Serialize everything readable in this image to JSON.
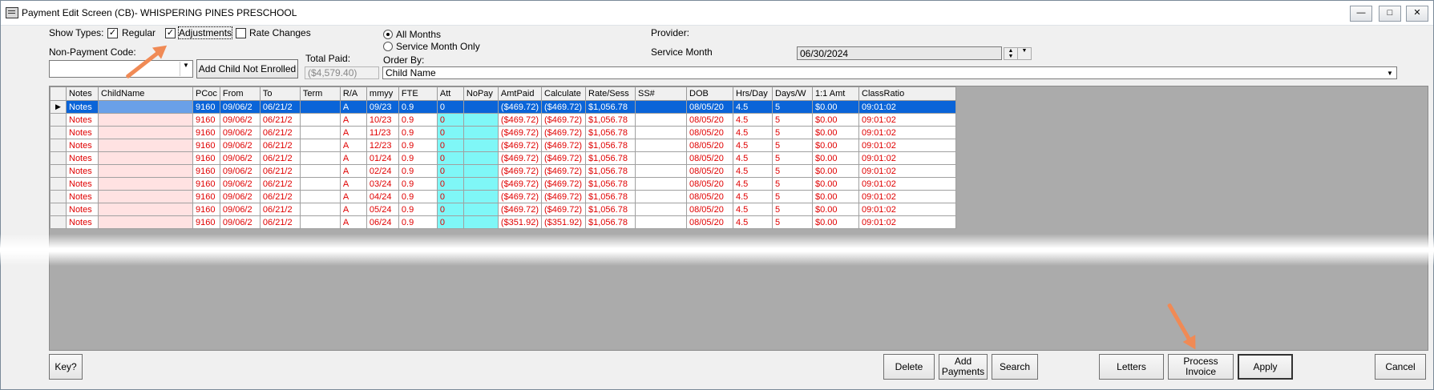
{
  "window": {
    "title": "Payment Edit Screen (CB)- WHISPERING PINES PRESCHOOL"
  },
  "filters": {
    "show_types_label": "Show Types:",
    "regular_label": "Regular",
    "regular_checked": true,
    "adjustments_label": "Adjustments",
    "adjustments_checked": true,
    "rate_changes_label": "Rate Changes",
    "rate_changes_checked": false,
    "all_months_label": "All Months",
    "service_month_only_label": "Service Month Only",
    "provider_label": "Provider:",
    "service_month_label": "Service Month",
    "service_month_value": "06/30/2024",
    "non_payment_code_label": "Non-Payment Code:",
    "non_payment_code_value": "",
    "add_child_button": "Add Child Not Enrolled",
    "total_paid_label": "Total Paid:",
    "total_paid_value": "($4,579.40)",
    "order_by_label": "Order By:",
    "order_by_value": "Child Name"
  },
  "grid": {
    "columns": [
      "Notes",
      "ChildName",
      "PCoc",
      "From",
      "To",
      "Term",
      "R/A",
      "mmyy",
      "FTE",
      "Att",
      "NoPay",
      "AmtPaid",
      "Calculate",
      "Rate/Sess",
      "SS#",
      "DOB",
      "Hrs/Day",
      "Days/W",
      "1:1 Amt",
      "ClassRatio"
    ],
    "rows": [
      {
        "notes": "Notes",
        "child": "",
        "pcoc": "9160",
        "from": "09/06/2",
        "to": "06/21/2",
        "term": "",
        "ra": "A",
        "mmyy": "09/23",
        "fte": "0.9",
        "att": "0",
        "nopay": "",
        "amtpaid": "($469.72)",
        "calc": "($469.72)",
        "rate": "$1,056.78",
        "ss": "",
        "dob": "08/05/20",
        "hrs": "4.5",
        "days": "5",
        "amt11": "$0.00",
        "ratio": "09:01:02"
      },
      {
        "notes": "Notes",
        "child": "",
        "pcoc": "9160",
        "from": "09/06/2",
        "to": "06/21/2",
        "term": "",
        "ra": "A",
        "mmyy": "10/23",
        "fte": "0.9",
        "att": "0",
        "nopay": "",
        "amtpaid": "($469.72)",
        "calc": "($469.72)",
        "rate": "$1,056.78",
        "ss": "",
        "dob": "08/05/20",
        "hrs": "4.5",
        "days": "5",
        "amt11": "$0.00",
        "ratio": "09:01:02"
      },
      {
        "notes": "Notes",
        "child": "",
        "pcoc": "9160",
        "from": "09/06/2",
        "to": "06/21/2",
        "term": "",
        "ra": "A",
        "mmyy": "11/23",
        "fte": "0.9",
        "att": "0",
        "nopay": "",
        "amtpaid": "($469.72)",
        "calc": "($469.72)",
        "rate": "$1,056.78",
        "ss": "",
        "dob": "08/05/20",
        "hrs": "4.5",
        "days": "5",
        "amt11": "$0.00",
        "ratio": "09:01:02"
      },
      {
        "notes": "Notes",
        "child": "",
        "pcoc": "9160",
        "from": "09/06/2",
        "to": "06/21/2",
        "term": "",
        "ra": "A",
        "mmyy": "12/23",
        "fte": "0.9",
        "att": "0",
        "nopay": "",
        "amtpaid": "($469.72)",
        "calc": "($469.72)",
        "rate": "$1,056.78",
        "ss": "",
        "dob": "08/05/20",
        "hrs": "4.5",
        "days": "5",
        "amt11": "$0.00",
        "ratio": "09:01:02"
      },
      {
        "notes": "Notes",
        "child": "",
        "pcoc": "9160",
        "from": "09/06/2",
        "to": "06/21/2",
        "term": "",
        "ra": "A",
        "mmyy": "01/24",
        "fte": "0.9",
        "att": "0",
        "nopay": "",
        "amtpaid": "($469.72)",
        "calc": "($469.72)",
        "rate": "$1,056.78",
        "ss": "",
        "dob": "08/05/20",
        "hrs": "4.5",
        "days": "5",
        "amt11": "$0.00",
        "ratio": "09:01:02"
      },
      {
        "notes": "Notes",
        "child": "",
        "pcoc": "9160",
        "from": "09/06/2",
        "to": "06/21/2",
        "term": "",
        "ra": "A",
        "mmyy": "02/24",
        "fte": "0.9",
        "att": "0",
        "nopay": "",
        "amtpaid": "($469.72)",
        "calc": "($469.72)",
        "rate": "$1,056.78",
        "ss": "",
        "dob": "08/05/20",
        "hrs": "4.5",
        "days": "5",
        "amt11": "$0.00",
        "ratio": "09:01:02"
      },
      {
        "notes": "Notes",
        "child": "",
        "pcoc": "9160",
        "from": "09/06/2",
        "to": "06/21/2",
        "term": "",
        "ra": "A",
        "mmyy": "03/24",
        "fte": "0.9",
        "att": "0",
        "nopay": "",
        "amtpaid": "($469.72)",
        "calc": "($469.72)",
        "rate": "$1,056.78",
        "ss": "",
        "dob": "08/05/20",
        "hrs": "4.5",
        "days": "5",
        "amt11": "$0.00",
        "ratio": "09:01:02"
      },
      {
        "notes": "Notes",
        "child": "",
        "pcoc": "9160",
        "from": "09/06/2",
        "to": "06/21/2",
        "term": "",
        "ra": "A",
        "mmyy": "04/24",
        "fte": "0.9",
        "att": "0",
        "nopay": "",
        "amtpaid": "($469.72)",
        "calc": "($469.72)",
        "rate": "$1,056.78",
        "ss": "",
        "dob": "08/05/20",
        "hrs": "4.5",
        "days": "5",
        "amt11": "$0.00",
        "ratio": "09:01:02"
      },
      {
        "notes": "Notes",
        "child": "",
        "pcoc": "9160",
        "from": "09/06/2",
        "to": "06/21/2",
        "term": "",
        "ra": "A",
        "mmyy": "05/24",
        "fte": "0.9",
        "att": "0",
        "nopay": "",
        "amtpaid": "($469.72)",
        "calc": "($469.72)",
        "rate": "$1,056.78",
        "ss": "",
        "dob": "08/05/20",
        "hrs": "4.5",
        "days": "5",
        "amt11": "$0.00",
        "ratio": "09:01:02"
      },
      {
        "notes": "Notes",
        "child": "",
        "pcoc": "9160",
        "from": "09/06/2",
        "to": "06/21/2",
        "term": "",
        "ra": "A",
        "mmyy": "06/24",
        "fte": "0.9",
        "att": "0",
        "nopay": "",
        "amtpaid": "($351.92)",
        "calc": "($351.92)",
        "rate": "$1,056.78",
        "ss": "",
        "dob": "08/05/20",
        "hrs": "4.5",
        "days": "5",
        "amt11": "$0.00",
        "ratio": "09:01:02"
      }
    ]
  },
  "buttons": {
    "key": "Key?",
    "delete": "Delete",
    "add_payments_1": "Add",
    "add_payments_2": "Payments",
    "search": "Search",
    "letters": "Letters",
    "process_invoice_1": "Process",
    "process_invoice_2": "Invoice",
    "apply": "Apply",
    "cancel": "Cancel"
  },
  "colors": {
    "row_text": "#e00000",
    "selection": "#0a64d8",
    "nopay_cell": "#7ff7f7",
    "annotation_arrow": "#f08a55"
  }
}
